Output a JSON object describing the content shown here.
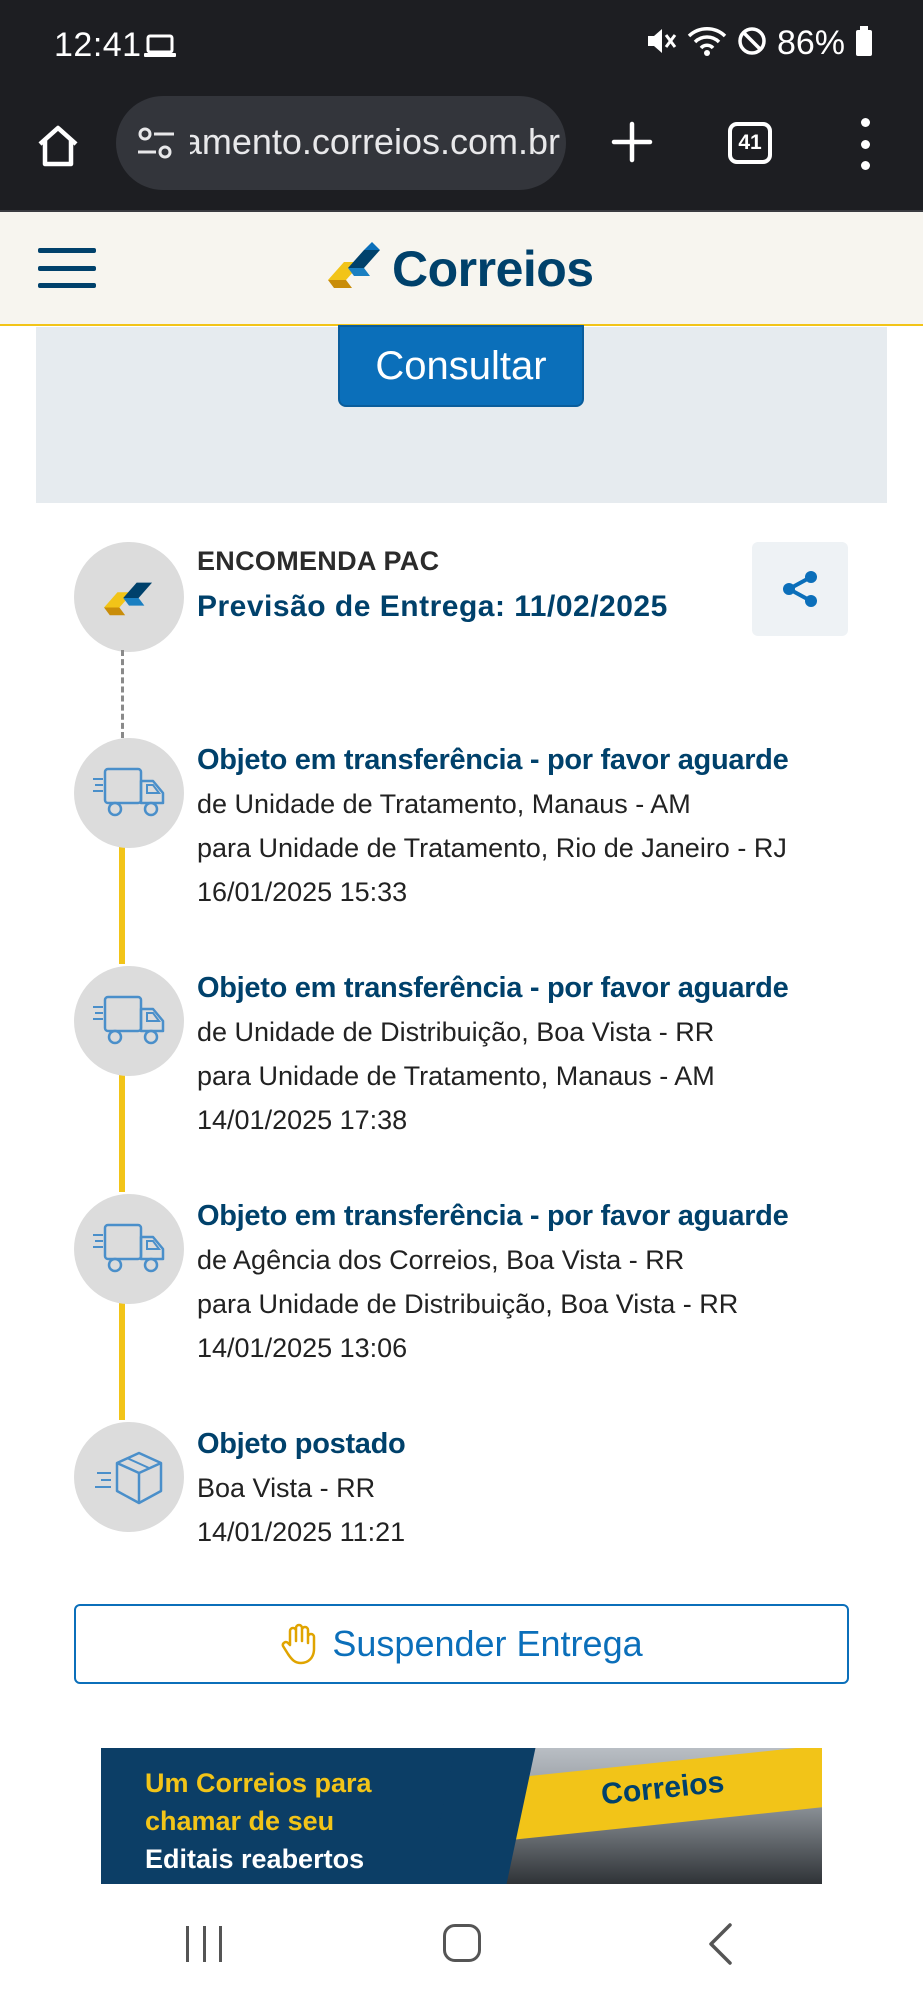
{
  "status_bar": {
    "time": "12:41",
    "battery": "86%"
  },
  "browser": {
    "url": "rastreamento.correios.com.br",
    "tab_count": "41"
  },
  "header": {
    "brand": "Correios"
  },
  "search": {
    "button_label": "Consultar"
  },
  "tracking": {
    "object_type": "ENCOMENDA PAC",
    "forecast": "Previsão de Entrega: 11/02/2025",
    "events": [
      {
        "title": "Objeto em transferência - por favor aguarde",
        "from": "de Unidade de Tratamento, Manaus - AM",
        "to": "para Unidade de Tratamento, Rio de Janeiro - RJ",
        "datetime": "16/01/2025 15:33",
        "icon": "truck-icon"
      },
      {
        "title": "Objeto em transferência - por favor aguarde",
        "from": "de Unidade de Distribuição, Boa Vista - RR",
        "to": "para Unidade de Tratamento, Manaus - AM",
        "datetime": "14/01/2025 17:38",
        "icon": "truck-icon"
      },
      {
        "title": "Objeto em transferência - por favor aguarde",
        "from": "de Agência dos Correios, Boa Vista - RR",
        "to": "para Unidade de Distribuição, Boa Vista - RR",
        "datetime": "14/01/2025 13:06",
        "icon": "truck-icon"
      },
      {
        "title": "Objeto postado",
        "location": "Boa Vista - RR",
        "datetime": "14/01/2025 11:21",
        "icon": "package-icon"
      }
    ],
    "suspend_label": "Suspender Entrega"
  },
  "banner": {
    "line1": "Um Correios para",
    "line2": "chamar de seu",
    "line3": "Editais reabertos",
    "sign_text": "Correios"
  },
  "colors": {
    "brand_blue": "#00416b",
    "button_blue": "#0b6fba",
    "brand_yellow": "#f2c418"
  }
}
